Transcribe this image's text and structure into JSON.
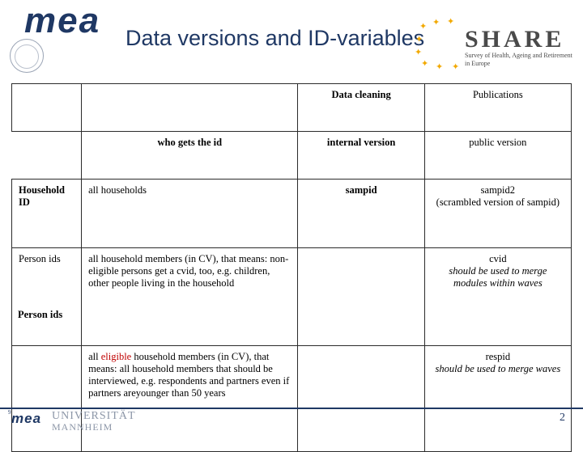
{
  "header": {
    "brand": "mea",
    "seal_text": "UNIVERSITÄT MANNHEIM",
    "title": "Data versions and ID-variables",
    "share_word": "SHARE",
    "share_subtitle": "Survey of Health, Ageing and Retirement in Europe"
  },
  "table": {
    "columns": {
      "col1": "",
      "col2": "",
      "col3": "Data cleaning",
      "col4": "Publications"
    },
    "subheader": {
      "col1": "",
      "col2": "who gets the id",
      "col3": "internal version",
      "col4": "public version"
    },
    "rows": [
      {
        "label": "Household ID",
        "who": "all households",
        "internal": "sampid",
        "public_main": "sampid2",
        "public_note": "(scrambled version of sampid)"
      },
      {
        "label": "Person ids",
        "who": "all household members (in CV), that means: non-eligible persons get a cvid, too, e.g. children, other people living in the household",
        "internal": "",
        "public_id": "cvid",
        "public_note": "should be used to merge modules within waves"
      },
      {
        "label": "",
        "who_pre": "all ",
        "who_red": "eligible",
        "who_post": " household members (in CV), that means: all household members that should be interviewed, e.g. respondents and partners even if partners areyounger than 50 years",
        "public_id": "respid",
        "public_note": "should be used to merge waves"
      }
    ]
  },
  "footer": {
    "brand": "mea",
    "mark": "9",
    "university_line1": "UNIVERSITÄT",
    "university_line2": "MANNHEIM",
    "page_number": "2"
  }
}
